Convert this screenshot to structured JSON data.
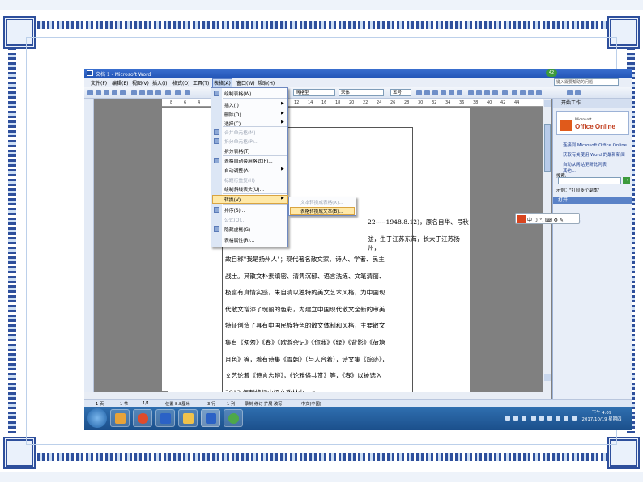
{
  "window": {
    "title": "文档 1 - Microsoft Word",
    "badge": "42"
  },
  "menu": {
    "items": [
      "文件(F)",
      "编辑(E)",
      "视图(V)",
      "插入(I)",
      "格式(O)",
      "工具(T)",
      "表格(A)",
      "窗口(W)",
      "帮助(H)"
    ],
    "active_index": 6,
    "help_placeholder": "键入需要帮助的问题"
  },
  "toolbar": {
    "style": "网格型",
    "font": "宋体",
    "size": "五号"
  },
  "ruler": {
    "ticks": [
      "8",
      "6",
      "4",
      "2",
      "2",
      "4",
      "6",
      "8",
      "10",
      "12",
      "14",
      "16",
      "18",
      "20",
      "22",
      "24",
      "26",
      "28",
      "30",
      "32",
      "34",
      "36",
      "38",
      "40",
      "42",
      "44"
    ]
  },
  "table_menu": {
    "items": [
      {
        "label": "绘制表格(W)",
        "disabled": false,
        "arrow": false,
        "icon": true
      },
      {
        "label": "插入(I)",
        "disabled": false,
        "arrow": true,
        "icon": false
      },
      {
        "label": "删除(D)",
        "disabled": false,
        "arrow": true,
        "icon": false
      },
      {
        "label": "选择(C)",
        "disabled": false,
        "arrow": true,
        "icon": false
      },
      {
        "label": "合并单元格(M)",
        "disabled": true,
        "arrow": false,
        "icon": true
      },
      {
        "label": "拆分单元格(P)...",
        "disabled": true,
        "arrow": false,
        "icon": true
      },
      {
        "label": "拆分表格(T)",
        "disabled": false,
        "arrow": false,
        "icon": false
      },
      {
        "label": "表格自动套用格式(F)...",
        "disabled": false,
        "arrow": false,
        "icon": true
      },
      {
        "label": "自动调整(A)",
        "disabled": false,
        "arrow": true,
        "icon": false
      },
      {
        "label": "标题行重复(H)",
        "disabled": true,
        "arrow": false,
        "icon": false
      },
      {
        "label": "绘制斜线表头(U)...",
        "disabled": false,
        "arrow": false,
        "icon": false
      },
      {
        "label": "转换(V)",
        "disabled": false,
        "arrow": true,
        "icon": false
      },
      {
        "label": "排序(S)...",
        "disabled": false,
        "arrow": false,
        "icon": true
      },
      {
        "label": "公式(O)...",
        "disabled": true,
        "arrow": false,
        "icon": false
      },
      {
        "label": "隐藏虚框(G)",
        "disabled": false,
        "arrow": false,
        "icon": true
      },
      {
        "label": "表格属性(R)...",
        "disabled": false,
        "arrow": false,
        "icon": false
      }
    ],
    "highlighted_index": 11
  },
  "convert_submenu": {
    "items": [
      "文本转换成表格(X)...",
      "表格转换成文本(B)..."
    ],
    "highlighted_index": 1
  },
  "document": {
    "first_line_tail": "22-----1948.8.12)，原名自华、号秋",
    "first_line_mid": "弦，生于江苏东海，长大于江苏扬州，",
    "lines": [
      "故自称\"我是扬州人\"；现代著名散文家、诗人、学者、民主",
      "战士。其散文朴素缜密、清隽沉郁、语言洗练、文笔清丽、",
      "极富有真情实感，朱自清以独特的美文艺术风格，为中国现",
      "代散文增添了瑰丽的色彩，为建立中国现代散文全新的审美",
      "特征创造了具有中国民族特色的散文体制和风格，主要散文",
      "集有《匆匆》《春》《欧游杂记》《你我》《绿》《背影》《荷塘",
      "月色》等，着有诗集《雪朝》（与人合着），诗文集《踪迹》，",
      "文艺论着《诗言志辨》，《论雅俗共赏》等，《春》以被选入",
      "2012 年新编初中语文教材中。↵"
    ]
  },
  "task_pane": {
    "title": "开始工作",
    "office_label": "Microsoft",
    "office_name": "Office Online",
    "links": [
      "连接到 Microsoft Office Online",
      "获取有关使用 Word 的最新新闻",
      "自动从网站更新此列表",
      "其他..."
    ],
    "search_label": "搜索:",
    "search_go": "→",
    "example": "示例：\"打印多个副本\"",
    "open_section": "打开",
    "new_doc": "新建文档..."
  },
  "ime": {
    "text": "中 ☽ °, ⌨ ⚙ ✎"
  },
  "status": {
    "page": "1 页",
    "section": "1 节",
    "pages": "1/1",
    "pos": "位置 8.8厘米",
    "line": "3 行",
    "col": "1 列",
    "modes": "录制 修订 扩展 改写",
    "lang": "中文(中国)"
  },
  "taskbar": {
    "time": "下午 4:09",
    "date": "2017/10/19 星期四"
  },
  "colors": {
    "frame": "#2e4f9c",
    "menu_highlight": "#ffe9a8",
    "taskbar": "#1b4f8b",
    "office_red": "#c03a1a"
  }
}
